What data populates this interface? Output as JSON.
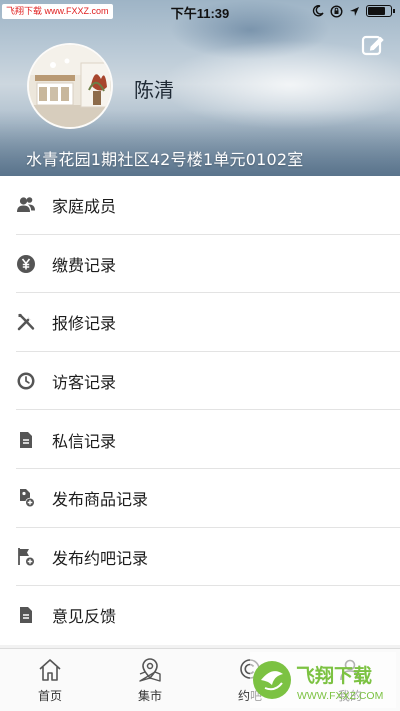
{
  "status_bar": {
    "site_badge": "飞翔下载 www.FXXZ.com",
    "time": "下午11:39",
    "battery_level": 0.8
  },
  "profile": {
    "name": "陈清",
    "address": "水青花园1期社区42号楼1单元0102室"
  },
  "menu": {
    "items": [
      {
        "label": "家庭成员",
        "icon": "family-icon"
      },
      {
        "label": "缴费记录",
        "icon": "yuan-icon"
      },
      {
        "label": "报修记录",
        "icon": "tools-icon"
      },
      {
        "label": "访客记录",
        "icon": "clock-icon"
      },
      {
        "label": "私信记录",
        "icon": "document-icon"
      },
      {
        "label": "发布商品记录",
        "icon": "tag-add-icon"
      },
      {
        "label": "发布约吧记录",
        "icon": "flag-add-icon"
      },
      {
        "label": "意见反馈",
        "icon": "document-icon"
      }
    ]
  },
  "tabbar": {
    "tabs": [
      {
        "label": "首页",
        "icon": "home-icon"
      },
      {
        "label": "集市",
        "icon": "map-pin-icon"
      },
      {
        "label": "约吧",
        "icon": "chat-icon"
      },
      {
        "label": "我的",
        "icon": "person-icon"
      }
    ]
  },
  "watermark": {
    "title": "飞翔下载",
    "url": "WWW.FXXZ.COM"
  },
  "colors": {
    "accent_green": "#7cc242",
    "badge_red": "#e02020",
    "icon_gray": "#555555"
  }
}
